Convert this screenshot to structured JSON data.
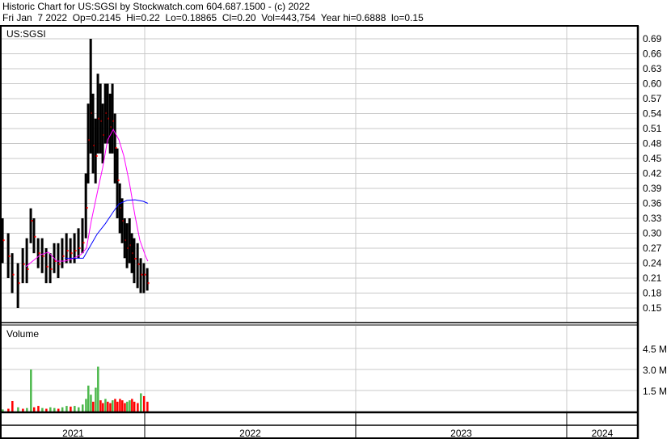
{
  "header": {
    "title": "Historic Chart for US:SGSI by Stockwatch.com 604.687.1500 - (c) 2022",
    "quote": "Fri Jan  7 2022  Op=0.2145  Hi=0.22  Lo=0.18865  Cl=0.20  Vol=443,754  Year hi=0.6888  lo=0.15"
  },
  "colors": {
    "price": "#000000",
    "ma_short": "#ff00ff",
    "ma_long": "#0000ff",
    "vol_up": "#4cb84c",
    "vol_down": "#ff0000",
    "grid": "#c8c8c8"
  },
  "chart_data": [
    {
      "type": "line",
      "title": "US:SGSI",
      "ylim": [
        0.13,
        0.7
      ],
      "yticks": [
        "0.69",
        "0.66",
        "0.63",
        "0.60",
        "0.57",
        "0.54",
        "0.51",
        "0.48",
        "0.45",
        "0.42",
        "0.39",
        "0.36",
        "0.33",
        "0.30",
        "0.27",
        "0.24",
        "0.21",
        "0.18",
        "0.15"
      ],
      "xlim": [
        2021.315,
        2024.33
      ],
      "xgrid": [
        2022,
        2023,
        2024
      ],
      "grid": true,
      "t": [
        2021.326,
        2021.353,
        2021.372,
        2021.399,
        2021.422,
        2021.441,
        2021.46,
        2021.475,
        2021.495,
        2021.514,
        2021.533,
        2021.552,
        2021.571,
        2021.59,
        2021.609,
        2021.629,
        2021.648,
        2021.667,
        2021.686,
        2021.705,
        2021.721,
        2021.732,
        2021.744,
        2021.755,
        2021.767,
        2021.778,
        2021.79,
        2021.801,
        2021.813,
        2021.824,
        2021.836,
        2021.847,
        2021.859,
        2021.87,
        2021.882,
        2021.893,
        2021.905,
        2021.916,
        2021.928,
        2021.939,
        2021.95,
        2021.966,
        2021.981,
        2021.996,
        2022.012
      ],
      "close": [
        0.286,
        0.254,
        0.217,
        0.2,
        0.238,
        0.228,
        0.325,
        0.293,
        0.26,
        0.254,
        0.233,
        0.228,
        0.244,
        0.238,
        0.254,
        0.265,
        0.26,
        0.265,
        0.27,
        0.281,
        0.351,
        0.487,
        0.541,
        0.476,
        0.455,
        0.53,
        0.525,
        0.497,
        0.541,
        0.53,
        0.513,
        0.525,
        0.471,
        0.406,
        0.351,
        0.325,
        0.286,
        0.27,
        0.276,
        0.26,
        0.249,
        0.238,
        0.217,
        0.217,
        0.2
      ],
      "high": [
        0.33,
        0.3,
        0.26,
        0.24,
        0.27,
        0.29,
        0.35,
        0.33,
        0.29,
        0.29,
        0.27,
        0.26,
        0.28,
        0.28,
        0.29,
        0.3,
        0.29,
        0.3,
        0.31,
        0.33,
        0.42,
        0.56,
        0.69,
        0.58,
        0.53,
        0.62,
        0.6,
        0.56,
        0.6,
        0.6,
        0.58,
        0.6,
        0.54,
        0.47,
        0.4,
        0.37,
        0.33,
        0.32,
        0.33,
        0.3,
        0.29,
        0.28,
        0.25,
        0.24,
        0.23
      ],
      "low": [
        0.24,
        0.21,
        0.18,
        0.15,
        0.2,
        0.2,
        0.28,
        0.26,
        0.23,
        0.22,
        0.2,
        0.2,
        0.22,
        0.21,
        0.23,
        0.24,
        0.24,
        0.24,
        0.25,
        0.26,
        0.29,
        0.4,
        0.46,
        0.42,
        0.4,
        0.46,
        0.46,
        0.44,
        0.48,
        0.48,
        0.46,
        0.46,
        0.4,
        0.33,
        0.3,
        0.28,
        0.25,
        0.23,
        0.24,
        0.22,
        0.2,
        0.19,
        0.18,
        0.18,
        0.185
      ],
      "ma_short": {
        "t": [
          2021.437,
          2021.506,
          2021.544,
          2021.583,
          2021.621,
          2021.659,
          2021.697,
          2021.724,
          2021.747,
          2021.774,
          2021.801,
          2021.824,
          2021.851,
          2021.878,
          2021.901,
          2021.928,
          2021.954,
          2021.977,
          2022.004,
          2022.015
        ],
        "values": [
          0.233,
          0.257,
          0.262,
          0.244,
          0.244,
          0.249,
          0.257,
          0.27,
          0.325,
          0.379,
          0.432,
          0.487,
          0.508,
          0.487,
          0.455,
          0.4,
          0.335,
          0.286,
          0.254,
          0.244
        ]
      },
      "ma_long": {
        "t": [
          2021.621,
          2021.709,
          2021.736,
          2021.774,
          2021.813,
          2021.851,
          2021.878,
          2021.916,
          2021.954,
          2021.993,
          2022.015
        ],
        "values": [
          0.25,
          0.25,
          0.27,
          0.298,
          0.319,
          0.343,
          0.359,
          0.366,
          0.367,
          0.364,
          0.36
        ]
      }
    },
    {
      "type": "bar",
      "title": "Volume",
      "yticks": [
        "4.5 M",
        "3.0 M",
        "1.5 M"
      ],
      "ytick_values": [
        4.5,
        3.0,
        1.5
      ],
      "ylim": [
        0,
        5.0
      ],
      "unit": "M",
      "volumes": [
        0.15,
        0.2,
        0.75,
        0.3,
        0.2,
        0.25,
        3.0,
        0.3,
        0.4,
        0.25,
        0.2,
        0.3,
        0.25,
        0.2,
        0.3,
        0.4,
        0.35,
        0.4,
        0.3,
        0.5,
        0.9,
        1.85,
        1.2,
        0.7,
        1.7,
        3.2,
        0.8,
        0.6,
        0.9,
        0.7,
        0.6,
        0.8,
        0.9,
        0.7,
        0.9,
        0.8,
        0.6,
        0.7,
        0.8,
        0.9,
        0.7,
        0.6,
        1.3,
        1.1,
        0.7
      ],
      "up": [
        true,
        false,
        false,
        true,
        false,
        true,
        true,
        false,
        false,
        true,
        false,
        true,
        true,
        false,
        true,
        true,
        false,
        true,
        true,
        true,
        true,
        true,
        true,
        false,
        true,
        true,
        false,
        false,
        true,
        false,
        false,
        true,
        false,
        false,
        false,
        false,
        false,
        true,
        true,
        false,
        false,
        false,
        true,
        false,
        false
      ]
    }
  ],
  "x_axis": {
    "years": [
      "2021",
      "2022",
      "2023",
      "2024"
    ]
  }
}
